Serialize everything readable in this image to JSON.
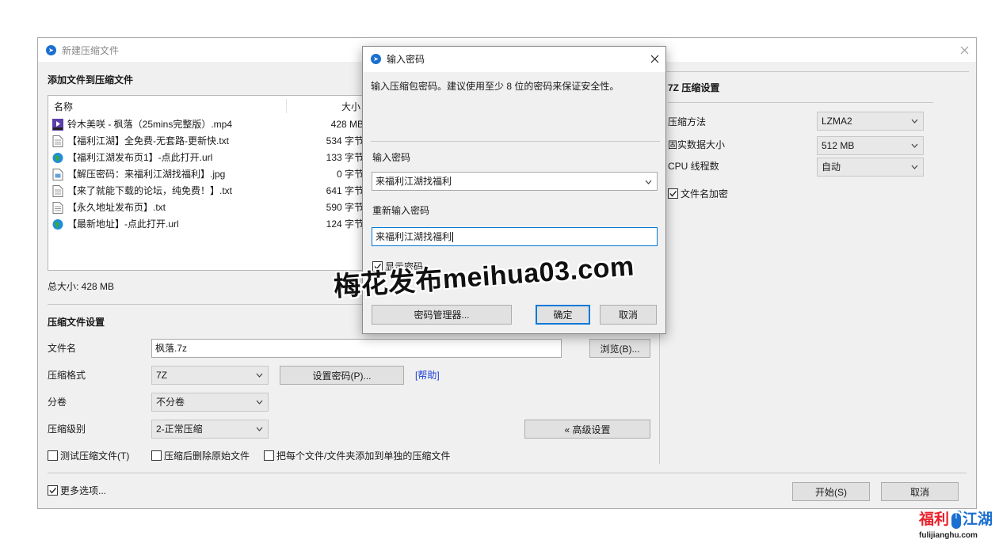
{
  "main_window": {
    "title": "新建压缩文件",
    "add_files_heading": "添加文件到压缩文件",
    "file_list": {
      "columns": [
        "名称",
        "大小"
      ],
      "rows": [
        {
          "name": "铃木美咲 - 枫落（25mins完整版）.mp4",
          "size": "428 MB",
          "icon": "video-file-icon"
        },
        {
          "name": "【福利江湖】全免费-无套路-更新快.txt",
          "size": "534 字节",
          "icon": "text-file-icon"
        },
        {
          "name": "【福利江湖发布页1】-点此打开.url",
          "size": "133 字节",
          "icon": "globe-icon"
        },
        {
          "name": "【解压密码：来福利江湖找福利】.jpg",
          "size": "0 字节",
          "icon": "image-file-icon"
        },
        {
          "name": "【来了就能下载的论坛，纯免费！】.txt",
          "size": "641 字节",
          "icon": "text-file-icon"
        },
        {
          "name": "【永久地址发布页】.txt",
          "size": "590 字节",
          "icon": "text-file-icon"
        },
        {
          "name": "【最新地址】-点此打开.url",
          "size": "124 字节",
          "icon": "globe-icon"
        }
      ]
    },
    "total_size": "总大小: 428 MB",
    "archive_settings_heading": "压缩文件设置",
    "filename_label": "文件名",
    "filename_value": "枫落.7z",
    "browse_button": "浏览(B)...",
    "format_label": "压缩格式",
    "format_value": "7Z",
    "set_password_button": "设置密码(P)...",
    "help_link": "[帮助]",
    "volume_label": "分卷",
    "volume_value": "不分卷",
    "level_label": "压缩级别",
    "level_value": "2-正常压缩",
    "advanced_button": "« 高级设置",
    "test_archive": "测试压缩文件(T)",
    "delete_after": "压缩后删除原始文件",
    "separate_archives": "把每个文件/文件夹添加到单独的压缩文件",
    "more_options": "更多选项...",
    "start_button": "开始(S)",
    "cancel_button": "取消",
    "seven_z": {
      "heading": "7Z 压缩设置",
      "method_label": "压缩方法",
      "method_value": "LZMA2",
      "solid_label": "固实数据大小",
      "solid_value": "512 MB",
      "cpu_label": "CPU 线程数",
      "cpu_value": "自动",
      "encrypt_names": "文件名加密"
    }
  },
  "password_dialog": {
    "title": "输入密码",
    "description": "输入压缩包密码。建议使用至少 8 位的密码来保证安全性。",
    "enter_label": "输入密码",
    "enter_value": "来福利江湖找福利",
    "reenter_label": "重新输入密码",
    "reenter_value": "来福利江湖找福利",
    "show_password": "显示密码",
    "manager_button": "密码管理器...",
    "ok_button": "确定",
    "cancel_button": "取消"
  },
  "watermark": "梅花发布meihua03.com",
  "corner_logo": {
    "left_text": "福利",
    "right_text": "江湖",
    "url": "fulijianghu.com",
    "colors": {
      "left": "#e8202a",
      "right": "#1a6fd1"
    }
  }
}
